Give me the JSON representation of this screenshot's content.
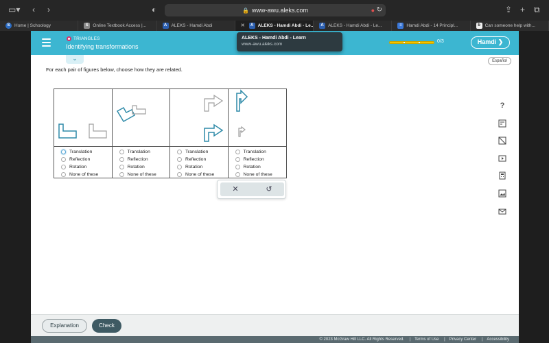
{
  "browser": {
    "url": "www-awu.aleks.com",
    "tabs": [
      {
        "label": "Home | Schoology",
        "icon": "schoology-icon",
        "active": false
      },
      {
        "label": "Online Textbook Access |...",
        "icon": "textbook-icon",
        "active": false
      },
      {
        "label": "ALEKS - Hamdi Abdi",
        "icon": "aleks-icon",
        "active": false
      },
      {
        "label": "ALEKS - Hamdi Abdi - Le...",
        "icon": "aleks-icon",
        "active": true
      },
      {
        "label": "ALEKS - Hamdi Abdi - Le...",
        "icon": "aleks-icon",
        "active": false
      },
      {
        "label": "Hamdi Abdi - 14 Principl...",
        "icon": "docs-icon",
        "active": false
      },
      {
        "label": "Can someone help with...",
        "icon": "brainly-icon",
        "active": false
      }
    ]
  },
  "header": {
    "topic_category": "TRIANGLES",
    "topic_title": "Identifying transformations",
    "progress_label": "0/3",
    "progress_fraction": 0.0,
    "user_name": "Hamdi"
  },
  "tooltip": {
    "title": "ALEKS - Hamdi Abdi - Learn",
    "url": "www-awu.aleks.com"
  },
  "language_button": "Español",
  "question_text": "For each pair of figures below, choose how they are related.",
  "answer_options": [
    "Translation",
    "Reflection",
    "Rotation",
    "None of these"
  ],
  "pairs": [
    {
      "figures": "two L-shapes side by side",
      "selected": null
    },
    {
      "figures": "L-shape rotated",
      "selected": null
    },
    {
      "figures": "two arrows stacked",
      "selected": null
    },
    {
      "figures": "large and small arrow",
      "selected": null
    }
  ],
  "side_tools": [
    "help-icon",
    "calculator-icon",
    "textbook-icon",
    "video-icon",
    "formula-icon",
    "image-icon",
    "mail-icon"
  ],
  "footer": {
    "explanation_label": "Explanation",
    "check_label": "Check",
    "copyright": "© 2023 McGraw Hill LLC. All Rights Reserved.",
    "terms": "Terms of Use",
    "privacy": "Privacy Center",
    "accessibility": "Accessibility"
  },
  "colors": {
    "header": "#3cb6d1",
    "figure_teal": "#2e8aa8",
    "figure_gray": "#a0a0a0",
    "check_button": "#3e5a63"
  }
}
